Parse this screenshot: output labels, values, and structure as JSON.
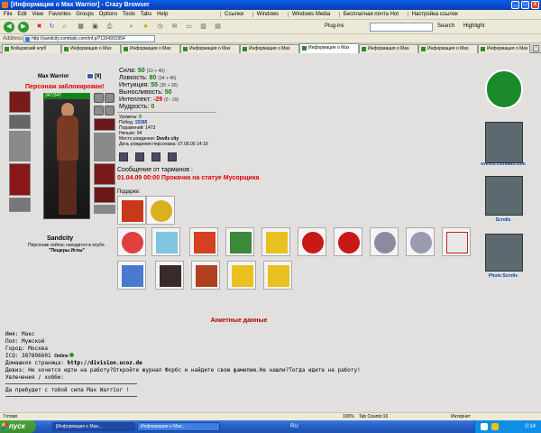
{
  "window": {
    "title": "[Информация о Max Warrior] - Crazy Browser",
    "min_label": "_",
    "max_label": "□",
    "close_label": "x"
  },
  "menu": {
    "items": [
      "File",
      "Edit",
      "View",
      "Favorites",
      "Groups",
      "Options",
      "Tools",
      "Tabs",
      "Help"
    ],
    "links": [
      "Ссылки",
      "Windows",
      "Windows Media",
      "Бесплатная почта Hot",
      "Настройка ссылок"
    ]
  },
  "toolbar": {
    "plugins_label": "Plug-ins",
    "search_label": "Search",
    "highlight_label": "Highlight"
  },
  "address": {
    "label": "Address",
    "url": "http://sandcity.combats.com/inf.pl?1154931954"
  },
  "tabs": [
    "Бойцовский клуб",
    "Информация о Max",
    "Информация о Max",
    "Информация о Max",
    "Информация о Max",
    "Информация о Max",
    "Информация о Max",
    "Информация о Max",
    "Информация о Max"
  ],
  "character": {
    "name": "Max Warrior",
    "level": "[9]",
    "blocked_text": "Персонаж заблокирован!",
    "hp": "347/347",
    "city": "Sandcity",
    "club_text": "Персонаж сейчас находится в клубе.",
    "club_location": "\"Пещеры Иглы\""
  },
  "stats": [
    {
      "name": "Сила:",
      "value": "50",
      "extra": "(10 + 40)",
      "red": false
    },
    {
      "name": "Ловкость:",
      "value": "80",
      "extra": "(34 + 46)",
      "red": false
    },
    {
      "name": "Интуиция:",
      "value": "55",
      "extra": "(35 + 20)",
      "red": false
    },
    {
      "name": "Выносливость:",
      "value": "50",
      "extra": "",
      "red": false
    },
    {
      "name": "Интеллект:",
      "value": "-29",
      "extra": "(0 - 29)",
      "red": true
    },
    {
      "name": "Мудрость:",
      "value": "0",
      "extra": "",
      "red": false
    }
  ],
  "info": {
    "levels_label": "Уровень:",
    "levels_value": "9",
    "wins_label": "Побед:",
    "wins_value": "15285",
    "losses_label": "Поражений:",
    "losses_value": "1473",
    "draws_label": "Ничьих:",
    "draws_value": "94",
    "birthplace_label": "Место рождения:",
    "birthplace_value": "Devils city",
    "birthday_label": "День рождения персонажа:",
    "birthday_value": "07.08.06 14:19"
  },
  "message": {
    "label": "Сообщение от тарманов :",
    "text": "01.04.09 00:00 Прокачка на статуе Мусорщика"
  },
  "gifts_label": "Подарки:",
  "right_panel": {
    "events_label": "events.combats.com",
    "scrolls_label": "Scrolls",
    "photo_scrolls_label": "Photo Scrolls"
  },
  "anket": {
    "title": "Анкетные данные",
    "name_line": "Имя: Макс",
    "sex_line": "Пол: Мужской",
    "city_line": "Город: Москва",
    "icq_line": "ICQ: 387896601",
    "icq_status": "Online",
    "homepage_label": "Домашняя страница: ",
    "homepage_url": "http://division.ucoz.de",
    "motto_line": "Девиз: Не хочется идти на работу?Откройте журнал Форбс и найдите свою фамилию.Не нашли?Тогда идите на работу!",
    "hobby_line": "Увлечения / хобби:",
    "quote": "Да пребудет с тобой сила Max Warrior !"
  },
  "statusbar": {
    "status": "Готово",
    "zoom": "100%",
    "tab_count": "Tab Counts:10",
    "zone": "Интернет"
  },
  "taskbar": {
    "start": "пуск",
    "tasks": [
      "[Информация о Max...",
      "Информация о Max..."
    ],
    "lang": "RU",
    "time": "0:14"
  }
}
